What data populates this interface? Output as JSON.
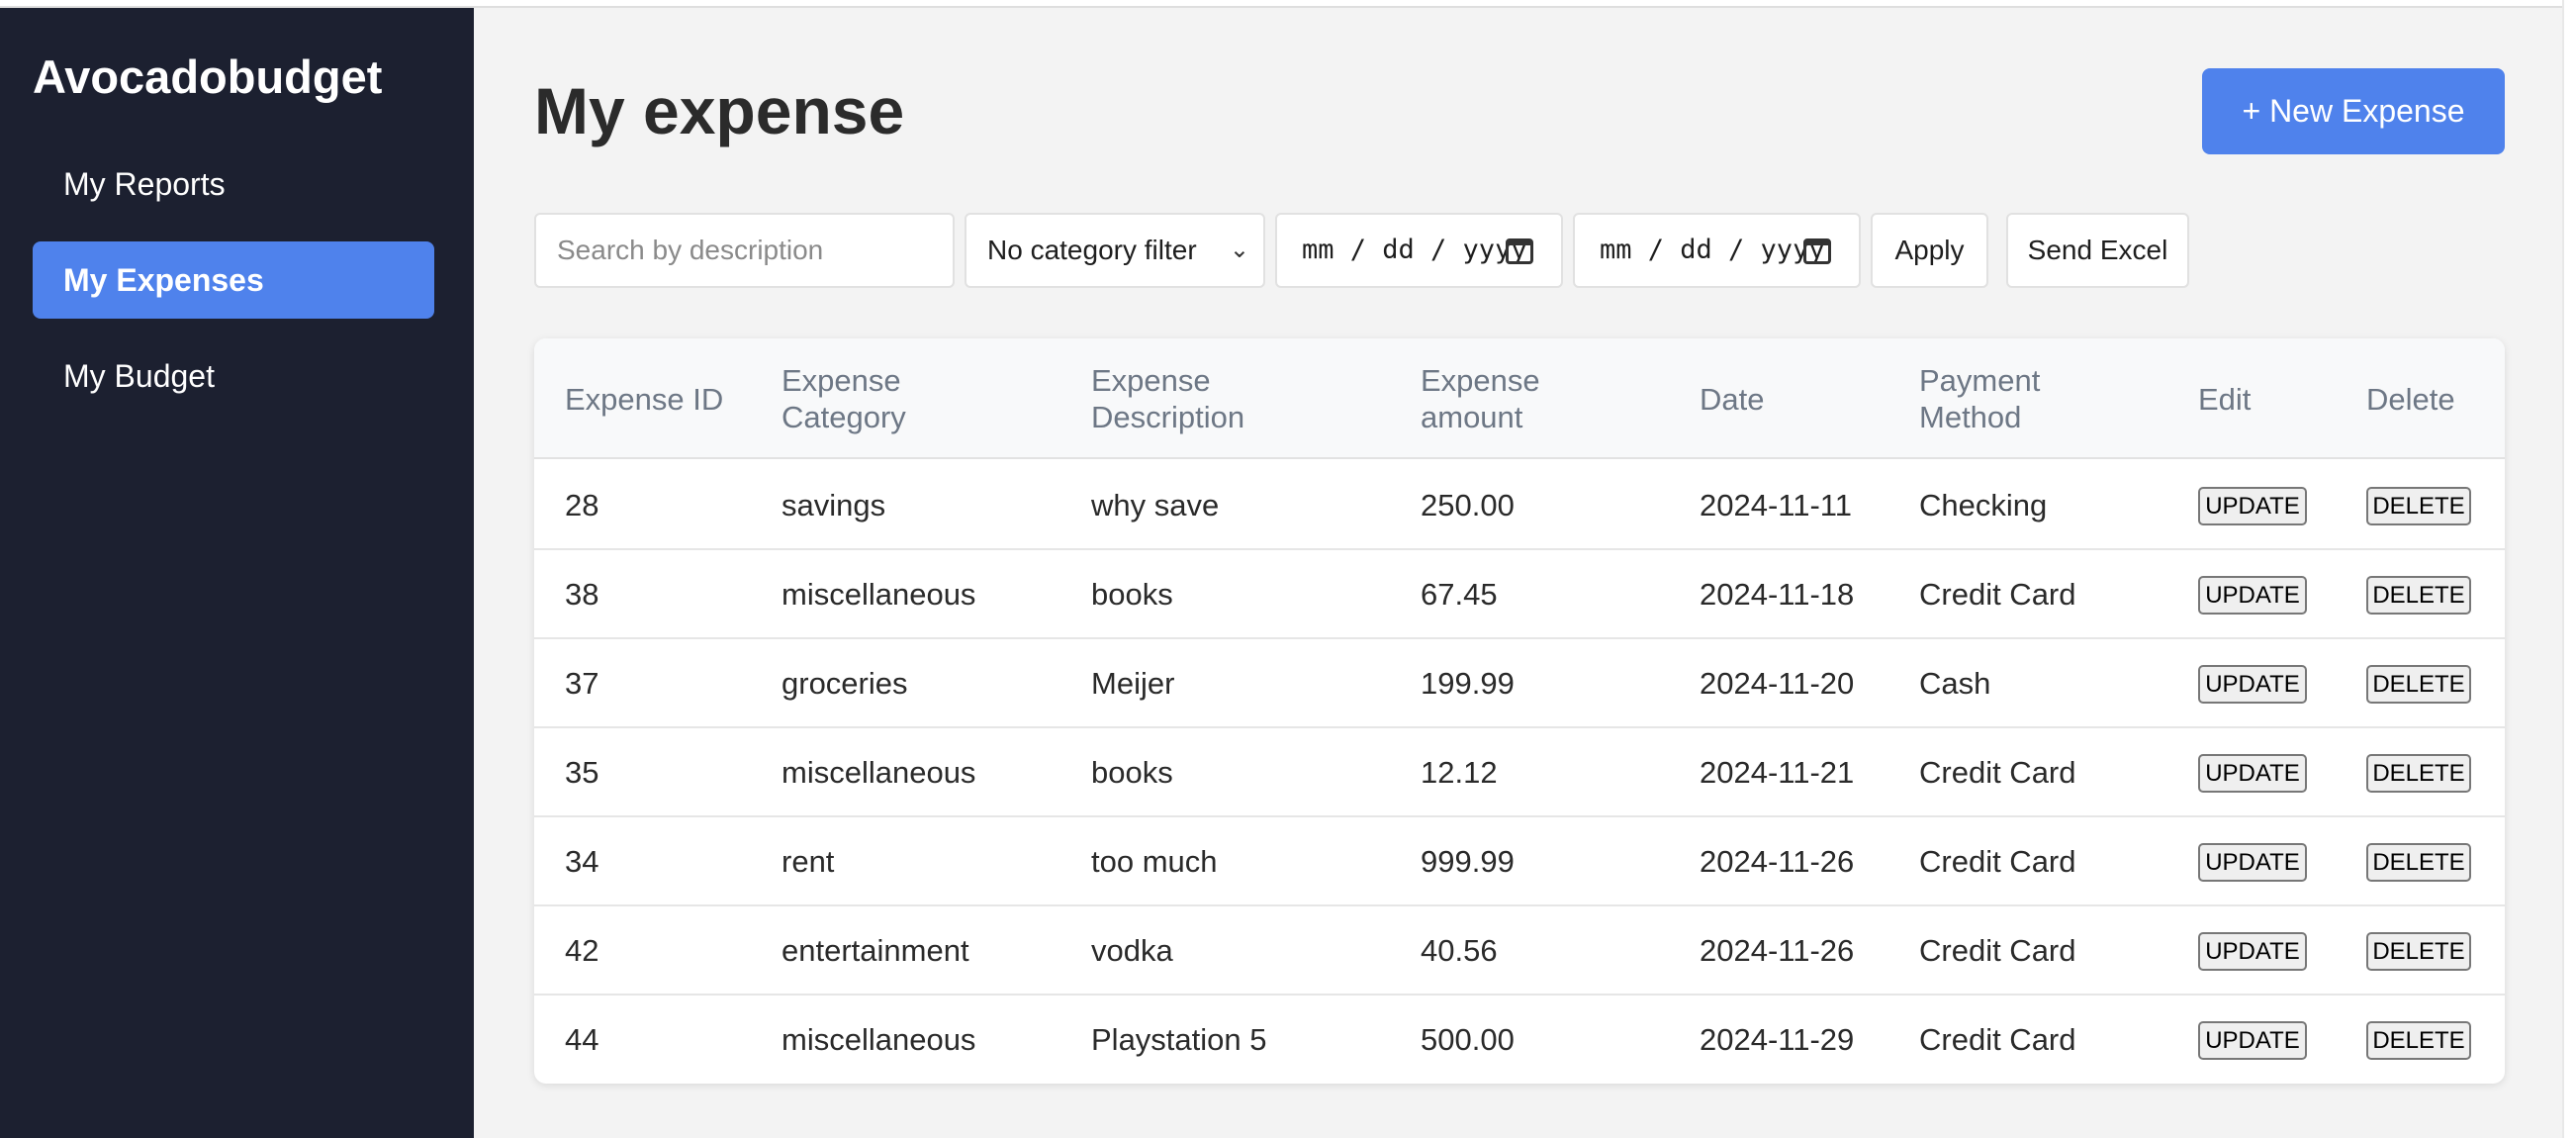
{
  "sidebar": {
    "brand": "Avocadobudget",
    "items": [
      {
        "label": "My Reports",
        "active": false
      },
      {
        "label": "My Expenses",
        "active": true
      },
      {
        "label": "My Budget",
        "active": false
      }
    ]
  },
  "header": {
    "title": "My expense",
    "new_button": "+ New Expense"
  },
  "filters": {
    "search_placeholder": "Search by description",
    "category_selected": "No category filter",
    "date_from": "mm / dd / yyyy",
    "date_to": "mm / dd / yyyy",
    "apply_label": "Apply",
    "excel_label": "Send Excel"
  },
  "table": {
    "headers": [
      "Expense ID",
      "Expense Category",
      "Expense Description",
      "Expense amount",
      "Date",
      "Payment Method",
      "Edit",
      "Delete"
    ],
    "update_label": "UPDATE",
    "delete_label": "DELETE",
    "rows": [
      {
        "id": "28",
        "category": "savings",
        "description": "why save",
        "amount": "250.00",
        "date": "2024-11-11",
        "method": "Checking"
      },
      {
        "id": "38",
        "category": "miscellaneous",
        "description": "books",
        "amount": "67.45",
        "date": "2024-11-18",
        "method": "Credit Card"
      },
      {
        "id": "37",
        "category": "groceries",
        "description": "Meijer",
        "amount": "199.99",
        "date": "2024-11-20",
        "method": "Cash"
      },
      {
        "id": "35",
        "category": "miscellaneous",
        "description": "books",
        "amount": "12.12",
        "date": "2024-11-21",
        "method": "Credit Card"
      },
      {
        "id": "34",
        "category": "rent",
        "description": "too much",
        "amount": "999.99",
        "date": "2024-11-26",
        "method": "Credit Card"
      },
      {
        "id": "42",
        "category": "entertainment",
        "description": "vodka",
        "amount": "40.56",
        "date": "2024-11-26",
        "method": "Credit Card"
      },
      {
        "id": "44",
        "category": "miscellaneous",
        "description": "Playstation 5",
        "amount": "500.00",
        "date": "2024-11-29",
        "method": "Credit Card"
      }
    ]
  },
  "colors": {
    "sidebar_bg": "#1c2030",
    "accent": "#4f82ec",
    "page_bg": "#f3f3f3"
  },
  "icons": {
    "calendar": "calendar-icon",
    "chevron": "chevron-down-icon"
  }
}
